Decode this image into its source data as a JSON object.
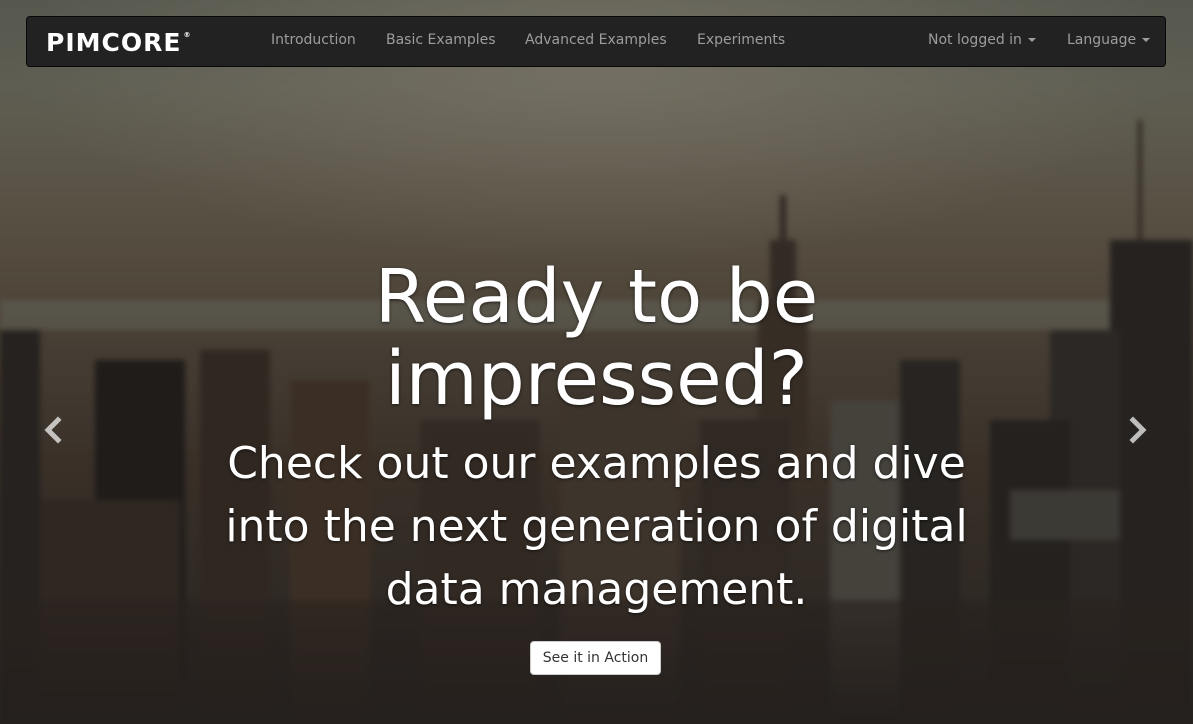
{
  "brand": {
    "name": "PIMCORE",
    "registered": "®"
  },
  "nav": {
    "links": [
      "Introduction",
      "Basic Examples",
      "Advanced Examples",
      "Experiments"
    ],
    "login": "Not logged in",
    "language": "Language"
  },
  "hero": {
    "headline_line1": "Ready to be",
    "headline_line2": "impressed?",
    "sub_line1": "Check out our examples and dive",
    "sub_line2": "into the next generation of digital",
    "sub_line3": "data management.",
    "cta_label": "See it in Action"
  },
  "icons": {
    "prev": "chevron-left-icon",
    "next": "chevron-right-icon"
  },
  "colors": {
    "navbar_bg": "#222222",
    "nav_text": "#9d9d9d",
    "hero_text": "#ffffff"
  }
}
